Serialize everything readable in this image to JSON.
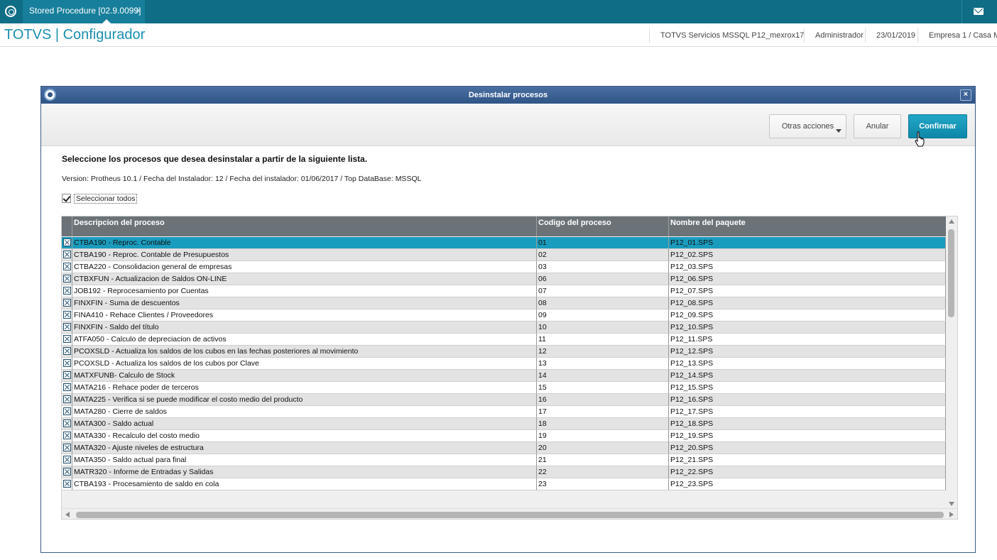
{
  "topbar": {
    "tab_label": "Stored Procedure [02.9.0099]",
    "tab_close": "×"
  },
  "header": {
    "brand": "TOTVS | Configurador",
    "environment": "TOTVS Servicios MSSQL P12_mexrox17",
    "user": "Administrador",
    "date": "23/01/2019",
    "company": "Empresa 1 / Casa M"
  },
  "dialog": {
    "title": "Desinstalar procesos",
    "close": "×",
    "buttons": {
      "more": "Otras acciones",
      "cancel": "Anular",
      "confirm": "Confirmar"
    },
    "instructions": "Seleccione los procesos que desea desinstalar a partir de la siguiente lista.",
    "version": "Version: Protheus 10.1 / Fecha del Instalador: 12 / Fecha del instalador: 01/06/2017 / Top DataBase: MSSQL",
    "select_all": "Seleccionar todos"
  },
  "grid": {
    "columns": [
      "Descripcion del proceso",
      "Codigo del proceso",
      "Nombre del paquete"
    ],
    "rows": [
      {
        "desc": "CTBA190 - Reproc. Contable",
        "code": "01",
        "pkg": "P12_01.SPS",
        "checked": true
      },
      {
        "desc": "CTBA190 - Reproc. Contable de Presupuestos",
        "code": "02",
        "pkg": "P12_02.SPS",
        "checked": true
      },
      {
        "desc": "CTBA220 - Consolidacion general de empresas",
        "code": "03",
        "pkg": "P12_03.SPS",
        "checked": true
      },
      {
        "desc": "CTBXFUN - Actualizacion de Saldos ON-LINE",
        "code": "06",
        "pkg": "P12_06.SPS",
        "checked": true
      },
      {
        "desc": "JOB192 - Reprocesamiento por Cuentas",
        "code": "07",
        "pkg": "P12_07.SPS",
        "checked": true
      },
      {
        "desc": "FINXFIN - Suma de descuentos",
        "code": "08",
        "pkg": "P12_08.SPS",
        "checked": true
      },
      {
        "desc": "FINA410 - Rehace Clientes / Proveedores",
        "code": "09",
        "pkg": "P12_09.SPS",
        "checked": true
      },
      {
        "desc": "FINXFIN - Saldo del título",
        "code": "10",
        "pkg": "P12_10.SPS",
        "checked": true
      },
      {
        "desc": "ATFA050 - Calculo de depreciacion de activos",
        "code": "11",
        "pkg": "P12_11.SPS",
        "checked": true
      },
      {
        "desc": "PCOXSLD - Actualiza los saldos de los cubos en las fechas posteriores al movimiento",
        "code": "12",
        "pkg": "P12_12.SPS",
        "checked": true
      },
      {
        "desc": "PCOXSLD - Actualiza los saldos de los cubos por Clave",
        "code": "13",
        "pkg": "P12_13.SPS",
        "checked": true
      },
      {
        "desc": "MATXFUNB- Calculo de Stock",
        "code": "14",
        "pkg": "P12_14.SPS",
        "checked": true
      },
      {
        "desc": "MATA216 - Rehace poder de terceros",
        "code": "15",
        "pkg": "P12_15.SPS",
        "checked": true
      },
      {
        "desc": "MATA225 - Verifica si se puede modificar el costo medio del producto",
        "code": "16",
        "pkg": "P12_16.SPS",
        "checked": true
      },
      {
        "desc": "MATA280 - Cierre de saldos",
        "code": "17",
        "pkg": "P12_17.SPS",
        "checked": true
      },
      {
        "desc": "MATA300 - Saldo actual",
        "code": "18",
        "pkg": "P12_18.SPS",
        "checked": true
      },
      {
        "desc": "MATA330 - Recalculo del costo medio",
        "code": "19",
        "pkg": "P12_19.SPS",
        "checked": true
      },
      {
        "desc": "MATA320 - Ajuste niveles de estructura",
        "code": "20",
        "pkg": "P12_20.SPS",
        "checked": true
      },
      {
        "desc": "MATA350 - Saldo actual para final",
        "code": "21",
        "pkg": "P12_21.SPS",
        "checked": true
      },
      {
        "desc": "MATR320 - Informe de Entradas y Salidas",
        "code": "22",
        "pkg": "P12_22.SPS",
        "checked": true
      },
      {
        "desc": "CTBA193 - Procesamiento de saldo en cola",
        "code": "23",
        "pkg": "P12_23.SPS",
        "checked": true
      }
    ]
  },
  "colors": {
    "topbar": "#0f6d86",
    "brand": "#1a8fb0",
    "dialog_title": "#2f5486",
    "confirm_button": "#1497b9",
    "selected_row": "#1a9cbe",
    "grid_header": "#6b7378"
  },
  "icons": {
    "app": "totvs-logo-icon",
    "mail": "mail-icon",
    "dialog": "protheus-icon",
    "cursor": "hand-pointer-icon"
  }
}
